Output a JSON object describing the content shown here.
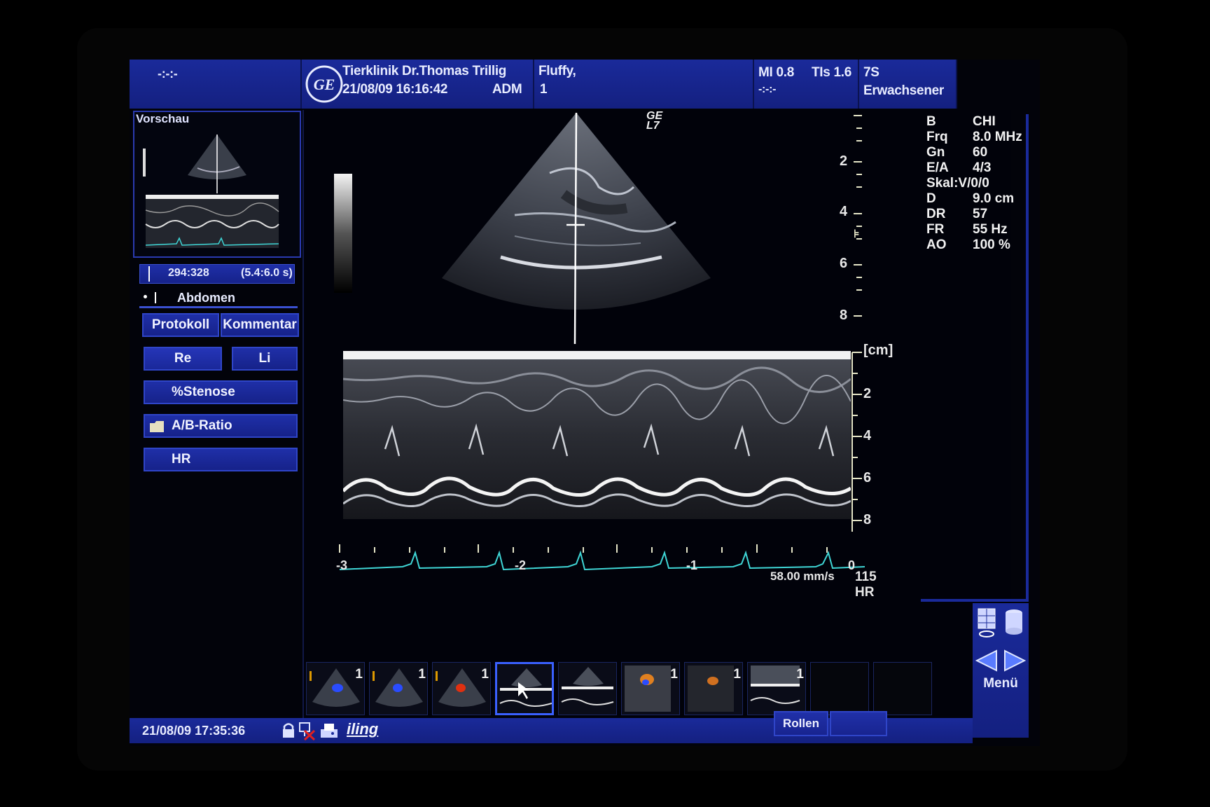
{
  "header": {
    "left_placeholder": "-:-:-",
    "clinic": "Tierklinik Dr.Thomas Trillig",
    "datetime": "21/08/09 16:16:42",
    "operator": "ADM",
    "patient_name": "Fluffy,",
    "patient_id": "1",
    "mi": "MI 0.8",
    "tis": "TIs 1.6",
    "mi_sub": "-:-:-",
    "probe": "7S",
    "preset": "Erwachsener",
    "logo_text": "GE"
  },
  "left": {
    "preview_label": "Vorschau",
    "cine_range": "294:328",
    "cine_time": "(5.4:6.0 s)",
    "exam": "Abdomen",
    "buttons": {
      "protokoll": "Protokoll",
      "kommentar": "Kommentar",
      "re": "Re",
      "li": "Li",
      "stenose": "%Stenose",
      "ab_ratio": "A/B-Ratio",
      "hr": "HR"
    }
  },
  "image": {
    "probe_mark": "GE L7",
    "depth_ticks": [
      "2",
      "4",
      "6",
      "8"
    ],
    "unit": "[cm]",
    "mmode_ticks": [
      "2",
      "4",
      "6",
      "8"
    ],
    "time_ticks": [
      "-3",
      "-2",
      "-1",
      "0"
    ],
    "sweep": "58.00 mm/s",
    "hr_value": "115",
    "hr_label": "HR"
  },
  "params": [
    {
      "key": "B",
      "value": "CHI"
    },
    {
      "key": "Frq",
      "value": "8.0 MHz"
    },
    {
      "key": "Gn",
      "value": "60"
    },
    {
      "key": "E/A",
      "value": "4/3"
    },
    {
      "key": "Skal:V/0/0",
      "value": ""
    },
    {
      "key": "D",
      "value": "9.0 cm"
    },
    {
      "key": "DR",
      "value": "57"
    },
    {
      "key": "FR",
      "value": "55 Hz"
    },
    {
      "key": "AO",
      "value": "100 %"
    }
  ],
  "thumbs": [
    {
      "n": "1",
      "kind": "color"
    },
    {
      "n": "1",
      "kind": "color"
    },
    {
      "n": "1",
      "kind": "color-red"
    },
    {
      "n": "",
      "kind": "mmode-selected"
    },
    {
      "n": "",
      "kind": "mmode"
    },
    {
      "n": "1",
      "kind": "doppler"
    },
    {
      "n": "1",
      "kind": "doppler-dark"
    },
    {
      "n": "1",
      "kind": "mmode"
    }
  ],
  "footer": {
    "datetime": "21/08/09 17:35:36",
    "brand": "iling",
    "scroll": "Rollen",
    "menu": "Menü"
  },
  "colors": {
    "panel": "#1a2a9a",
    "ecg": "#3fd6d6",
    "scale": "#e6e6c8"
  }
}
